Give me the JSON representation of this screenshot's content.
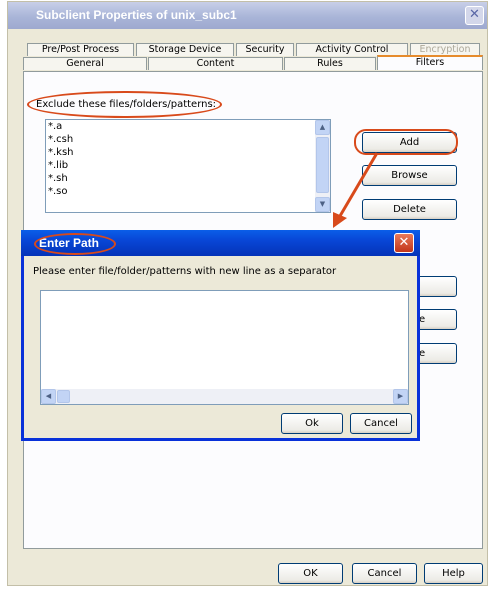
{
  "main_window": {
    "title": "Subclient Properties of unix_subc1",
    "close_glyph": "✕",
    "tabs_row1": [
      {
        "label": "Pre/Post Process"
      },
      {
        "label": "Storage Device"
      },
      {
        "label": "Security"
      },
      {
        "label": "Activity Control"
      },
      {
        "label": "Encryption"
      }
    ],
    "tabs_row2": [
      {
        "label": "General"
      },
      {
        "label": "Content"
      },
      {
        "label": "Rules"
      },
      {
        "label": "Filters"
      }
    ],
    "exclude_label": "Exclude these files/folders/patterns:",
    "exclude_items": [
      "*.a",
      "*.csh",
      "*.ksh",
      "*.lib",
      "*.sh",
      "*.so"
    ],
    "buttons": {
      "add": "Add",
      "browse": "Browse",
      "delete": "Delete",
      "hidden2_partial": "e",
      "hidden3_partial": "e",
      "ok": "OK",
      "cancel": "Cancel",
      "help": "Help"
    }
  },
  "dialog": {
    "title": "Enter Path",
    "close_glyph": "✕",
    "instruction": "Please enter file/folder/patterns with new line as a separator",
    "input_value": "",
    "ok": "Ok",
    "cancel": "Cancel"
  },
  "colors": {
    "annotation": "#d84a1b",
    "dialog_title_bg": "#0846d6",
    "main_title_bg": "#a9b5d8"
  },
  "icons": {
    "close": "close-icon",
    "scroll_up": "arrow-up-icon",
    "scroll_down": "arrow-down-icon",
    "scroll_left": "arrow-left-icon",
    "scroll_right": "arrow-right-icon"
  }
}
